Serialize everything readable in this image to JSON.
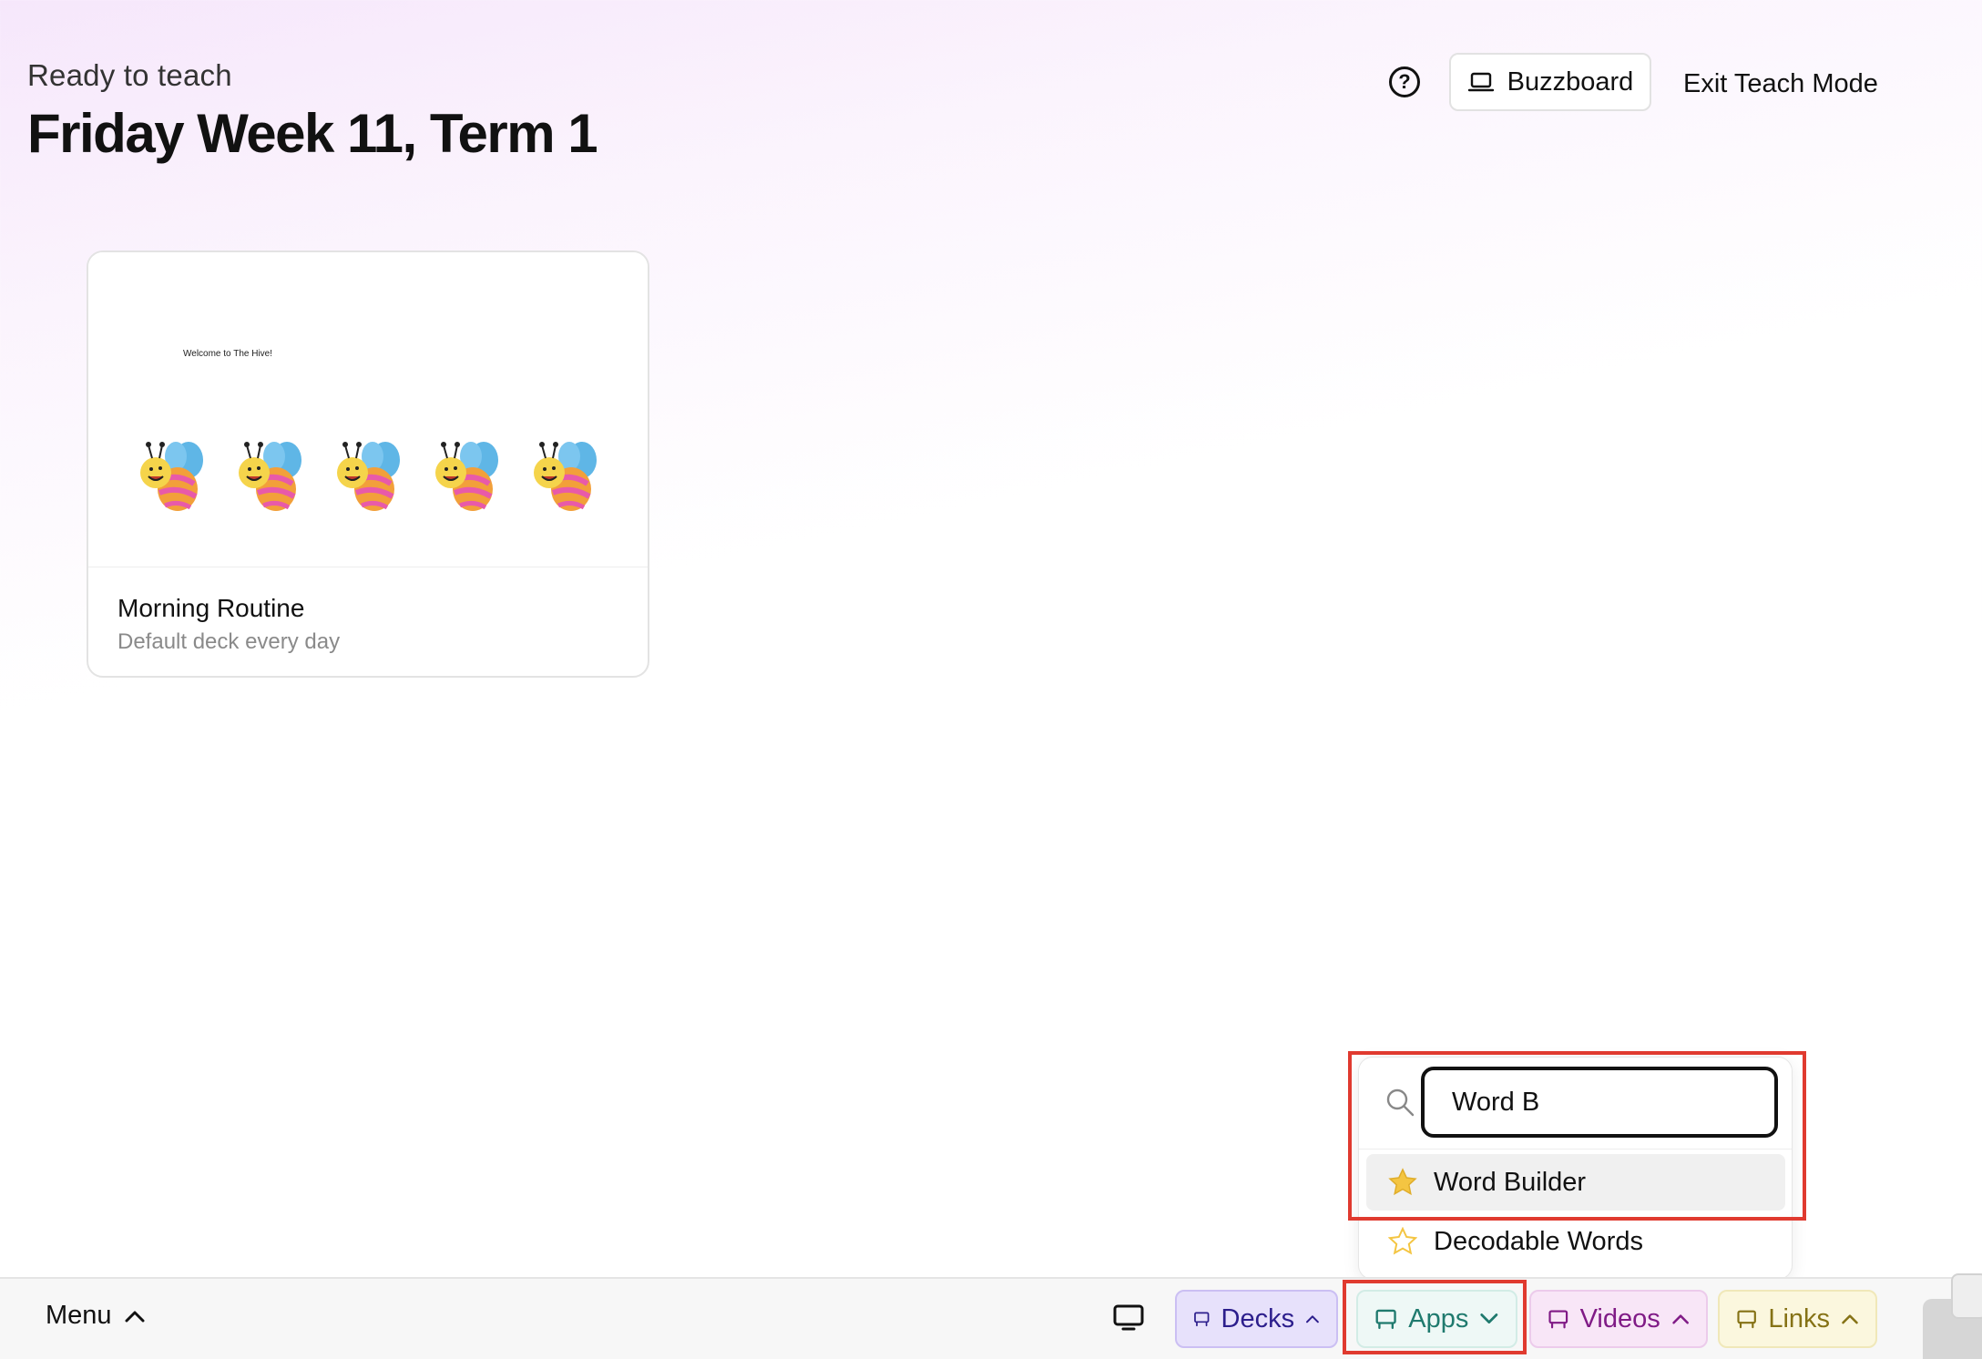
{
  "header": {
    "subtitle": "Ready to teach",
    "title": "Friday Week 11, Term 1",
    "help_icon": "question-circle-icon",
    "buzzboard_label": "Buzzboard",
    "exit_label": "Exit Teach Mode"
  },
  "deck_card": {
    "thumbnail_text": "Welcome to The Hive!",
    "title": "Morning Routine",
    "subtitle": "Default deck every day"
  },
  "apps_dropdown": {
    "search_value": "Word B",
    "items": [
      {
        "label": "Word Builder",
        "favorite": true
      },
      {
        "label": "Decodable Words",
        "favorite": false
      }
    ]
  },
  "bottom_bar": {
    "menu_label": "Menu",
    "tabs": [
      {
        "label": "Decks",
        "color": "#2c1e8c"
      },
      {
        "label": "Apps",
        "color": "#1f7a6e"
      },
      {
        "label": "Videos",
        "color": "#801b86"
      },
      {
        "label": "Links",
        "color": "#857215"
      }
    ]
  },
  "colors": {
    "annotation": "#e03a2f",
    "favorite_star": "#f4c542"
  }
}
